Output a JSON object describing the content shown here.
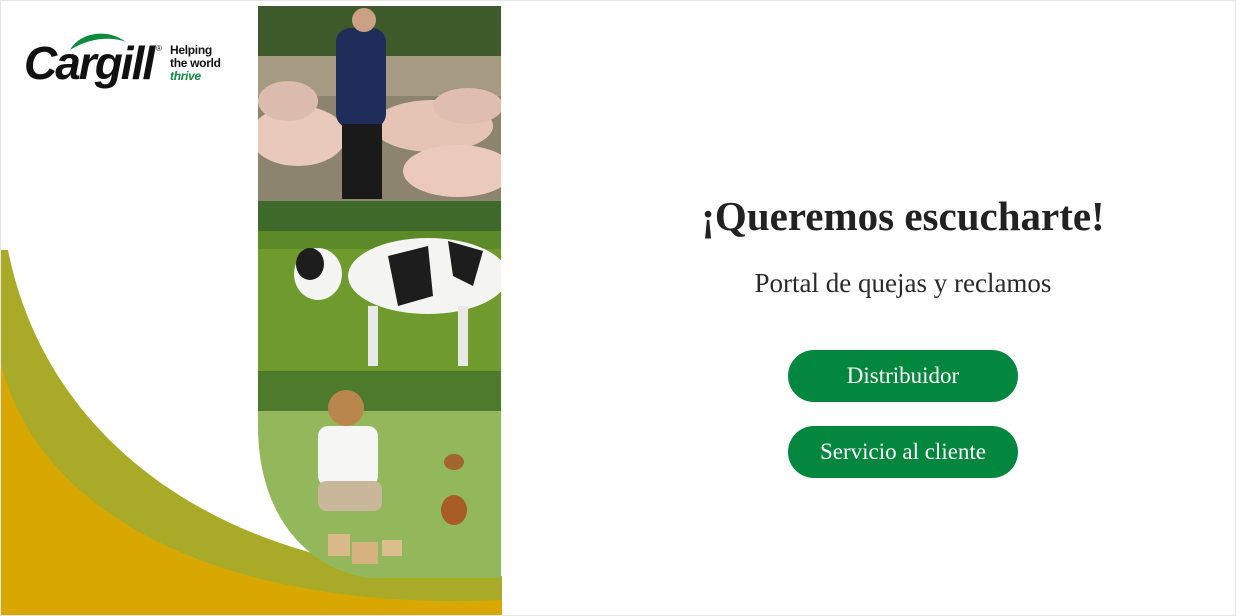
{
  "brand": {
    "name": "Cargill",
    "registered": "®",
    "tagline_line1": "Helping",
    "tagline_line2": "the world",
    "tagline_line3": "thrive"
  },
  "main": {
    "title": "¡Queremos escucharte!",
    "subtitle": "Portal de quejas y reclamos",
    "buttons": {
      "distribuidor": "Distribuidor",
      "servicio": "Servicio al cliente"
    }
  },
  "colors": {
    "accent_green": "#03873e",
    "swoosh_olive": "#a9ab28",
    "swoosh_gold": "#d9a800",
    "logo_leaf_green": "#0d8a3c"
  },
  "images": {
    "banner": "farm-collage-image"
  }
}
